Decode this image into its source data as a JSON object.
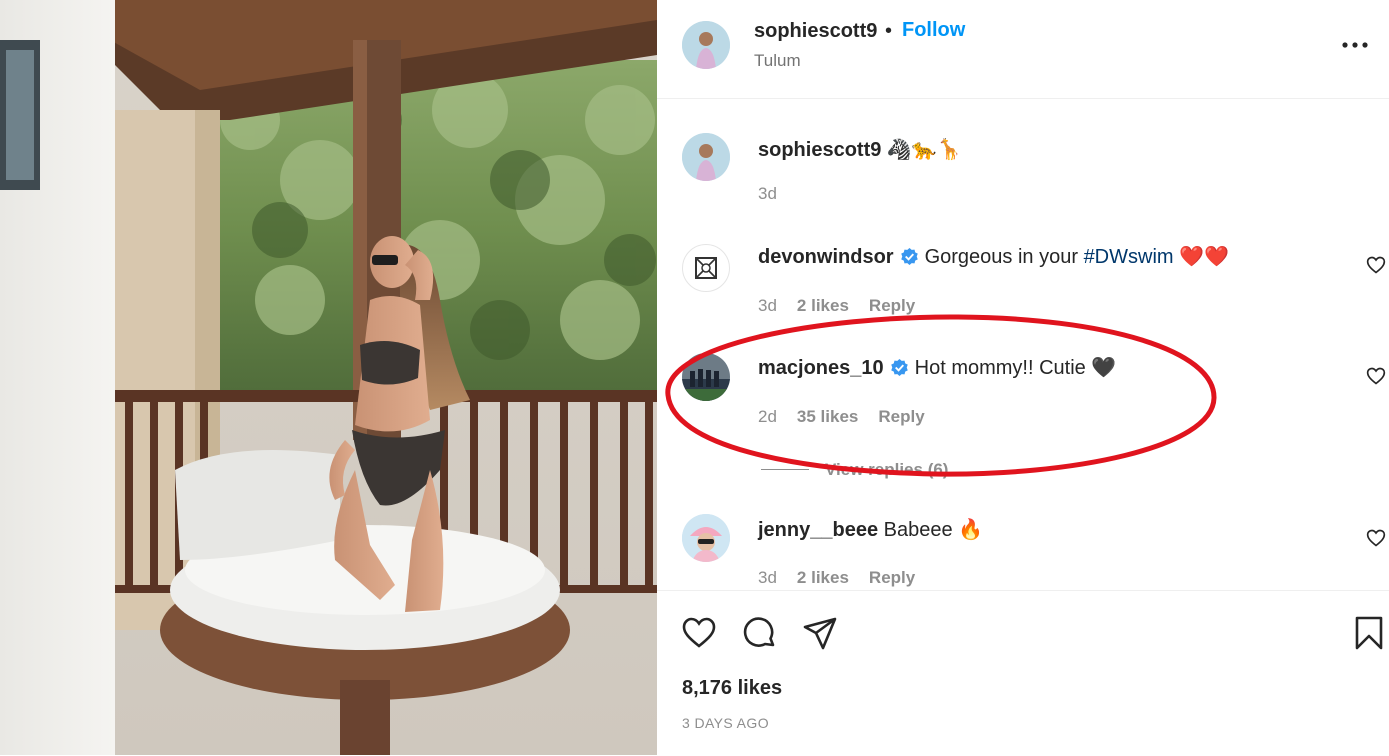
{
  "post": {
    "author": "sophiescott9",
    "separator": "•",
    "follow_label": "Follow",
    "location": "Tulum",
    "more_icon": "more-horizontal-icon"
  },
  "caption": {
    "user": "sophiescott9",
    "emojis": "🦓🐆🦒",
    "time": "3d"
  },
  "comments": [
    {
      "user": "devonwindsor",
      "verified": true,
      "text_before": "Gorgeous in your ",
      "hashtag": "#DWswim",
      "text_after": " ❤️❤️",
      "time": "3d",
      "likes": "2 likes",
      "reply": "Reply"
    },
    {
      "user": "macjones_10",
      "verified": true,
      "text": "Hot mommy!! Cutie 🖤",
      "time": "2d",
      "likes": "35 likes",
      "reply": "Reply",
      "view_replies": "View replies (6)"
    },
    {
      "user": "jenny__beee",
      "verified": false,
      "text": "Babeee 🔥",
      "time": "3d",
      "likes": "2 likes",
      "reply": "Reply"
    }
  ],
  "actions": {
    "like_icon": "heart-icon",
    "comment_icon": "comment-icon",
    "share_icon": "send-icon",
    "save_icon": "bookmark-icon"
  },
  "likes_count": "8,176 likes",
  "posted_ago": "3 DAYS AGO",
  "colors": {
    "accent": "#0095f6",
    "verified": "#3897f0",
    "annotation": "#e0141e",
    "text": "#262626",
    "muted": "#8e8e8e"
  }
}
